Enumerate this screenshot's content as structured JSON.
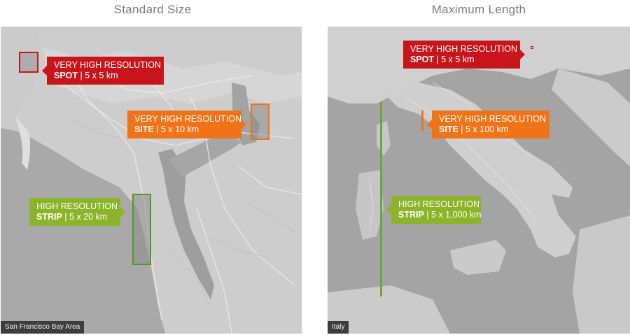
{
  "panels": [
    {
      "title": "Standard Size",
      "caption": "San Francisco Bay Area",
      "callouts": [
        {
          "line1": "VERY HIGH RESOLUTION",
          "product": "SPOT",
          "size": "| 5 x 5 km",
          "color": "#c8141b"
        },
        {
          "line1": "VERY HIGH RESOLUTION",
          "product": "SITE",
          "size": "| 5 x 10 km",
          "color": "#f07318"
        },
        {
          "line1": "HIGH RESOLUTION",
          "product": "STRIP",
          "size": "| 5 x 20 km",
          "color": "#8cb42a"
        }
      ]
    },
    {
      "title": "Maximum Length",
      "caption": "Italy",
      "callouts": [
        {
          "line1": "VERY HIGH RESOLUTION",
          "product": "SPOT",
          "size": "| 5 x 5 km",
          "color": "#c8141b"
        },
        {
          "line1": "VERY HIGH RESOLUTION",
          "product": "SITE",
          "size": "| 5 x 100 km",
          "color": "#f07318"
        },
        {
          "line1": "HIGH RESOLUTION",
          "product": "STRIP",
          "size": "| 5 x 1,000 km",
          "color": "#8cb42a"
        }
      ]
    }
  ]
}
